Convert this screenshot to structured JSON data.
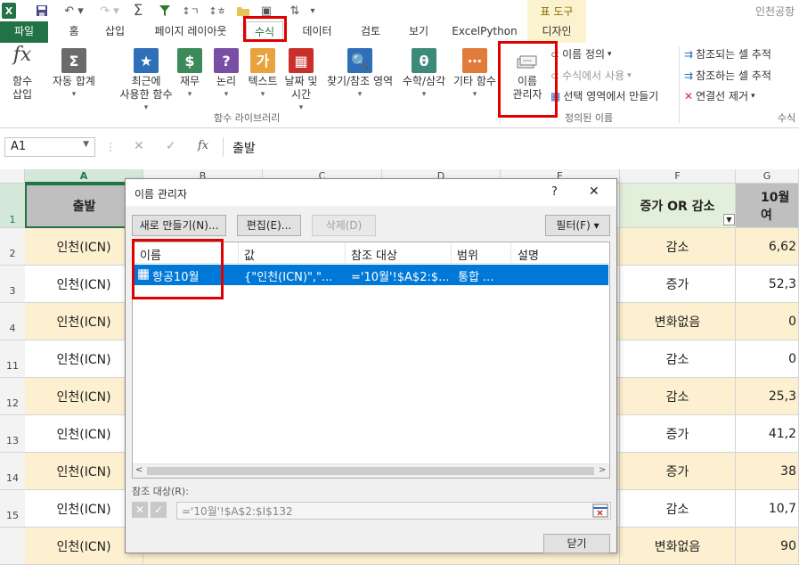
{
  "qat": {
    "file_icon": "X",
    "workbook_title": "인천공항"
  },
  "tabs": [
    "파일",
    "홈",
    "삽입",
    "페이지 레이아웃",
    "수식",
    "데이터",
    "검토",
    "보기",
    "ExcelPython",
    "디자인"
  ],
  "context_tab_header": "표 도구",
  "ribbon": {
    "insert_function": "함수\n삽입",
    "functions": [
      {
        "label": "자동 합계",
        "color": "#6b6b6b",
        "icon": "Σ"
      },
      {
        "label": "최근에\n사용한 함수",
        "color": "#2e6fb8",
        "icon": "★"
      },
      {
        "label": "재무",
        "color": "#3c8a5a",
        "icon": "$"
      },
      {
        "label": "논리",
        "color": "#7b4ea6",
        "icon": "?"
      },
      {
        "label": "텍스트",
        "color": "#e8a33c",
        "icon": "가"
      },
      {
        "label": "날짜 및\n시간",
        "color": "#c9302c",
        "icon": "▦"
      },
      {
        "label": "찾기/참조 영역",
        "color": "#2e6fb8",
        "icon": "🔍"
      },
      {
        "label": "수학/삼각",
        "color": "#3c8a7a",
        "icon": "θ"
      },
      {
        "label": "기타 함수",
        "color": "#e07b39",
        "icon": "⋯"
      }
    ],
    "group_function_library": "함수 라이브러리",
    "name_manager": "이름\n관리자",
    "define_name": "이름 정의",
    "use_in_formula": "수식에서 사용",
    "create_from_selection": "선택 영역에서 만들기",
    "group_defined_names": "정의된 이름",
    "trace_precedents": "참조되는 셀 추적",
    "trace_dependents": "참조하는 셀 추적",
    "remove_arrows": "연결선 제거",
    "group_formula_auditing": "수식"
  },
  "formula_bar": {
    "name_box": "A1",
    "fx": "fx",
    "content": "출발"
  },
  "columns": [
    "A",
    "B",
    "C",
    "D",
    "E",
    "F",
    "G"
  ],
  "header_row": {
    "A": "출발",
    "F": "증가 OR 감소",
    "G": "10월여"
  },
  "rows": [
    {
      "num": "1"
    },
    {
      "num": "2",
      "A": "인천(ICN)",
      "F": "감소",
      "G": "6,62"
    },
    {
      "num": "3",
      "A": "인천(ICN)",
      "F": "증가",
      "G": "52,3"
    },
    {
      "num": "4",
      "A": "인천(ICN)",
      "F": "변화없음",
      "G": "0"
    },
    {
      "num": "11",
      "A": "인천(ICN)",
      "F": "감소",
      "G": "0"
    },
    {
      "num": "12",
      "A": "인천(ICN)",
      "F": "감소",
      "G": "25,3"
    },
    {
      "num": "13",
      "A": "인천(ICN)",
      "F": "증가",
      "G": "41,2"
    },
    {
      "num": "14",
      "A": "인천(ICN)",
      "F": "증가",
      "G": "38"
    },
    {
      "num": "15",
      "A": "인천(ICN)",
      "F": "감소",
      "G": "10,7"
    },
    {
      "num": "",
      "A": "인천(ICN)",
      "F": "변화없음",
      "G": "90"
    }
  ],
  "dialog": {
    "title": "이름 관리자",
    "help": "?",
    "close_x": "✕",
    "new_button": "새로 만들기(N)...",
    "edit_button": "편집(E)...",
    "delete_button": "삭제(D)",
    "filter_button": "필터(F) ▾",
    "columns": [
      "이름",
      "값",
      "참조 대상",
      "범위",
      "설명"
    ],
    "entry": {
      "name": "항공10월",
      "value": "{\"인천(ICN)\",\"...",
      "refers_to": "='10월'!$A$2:$...",
      "scope": "통합 ...",
      "comment": ""
    },
    "refers_to_label": "참조 대상(R):",
    "refers_to_value": "='10월'!$A$2:$I$132",
    "close_button": "닫기"
  }
}
